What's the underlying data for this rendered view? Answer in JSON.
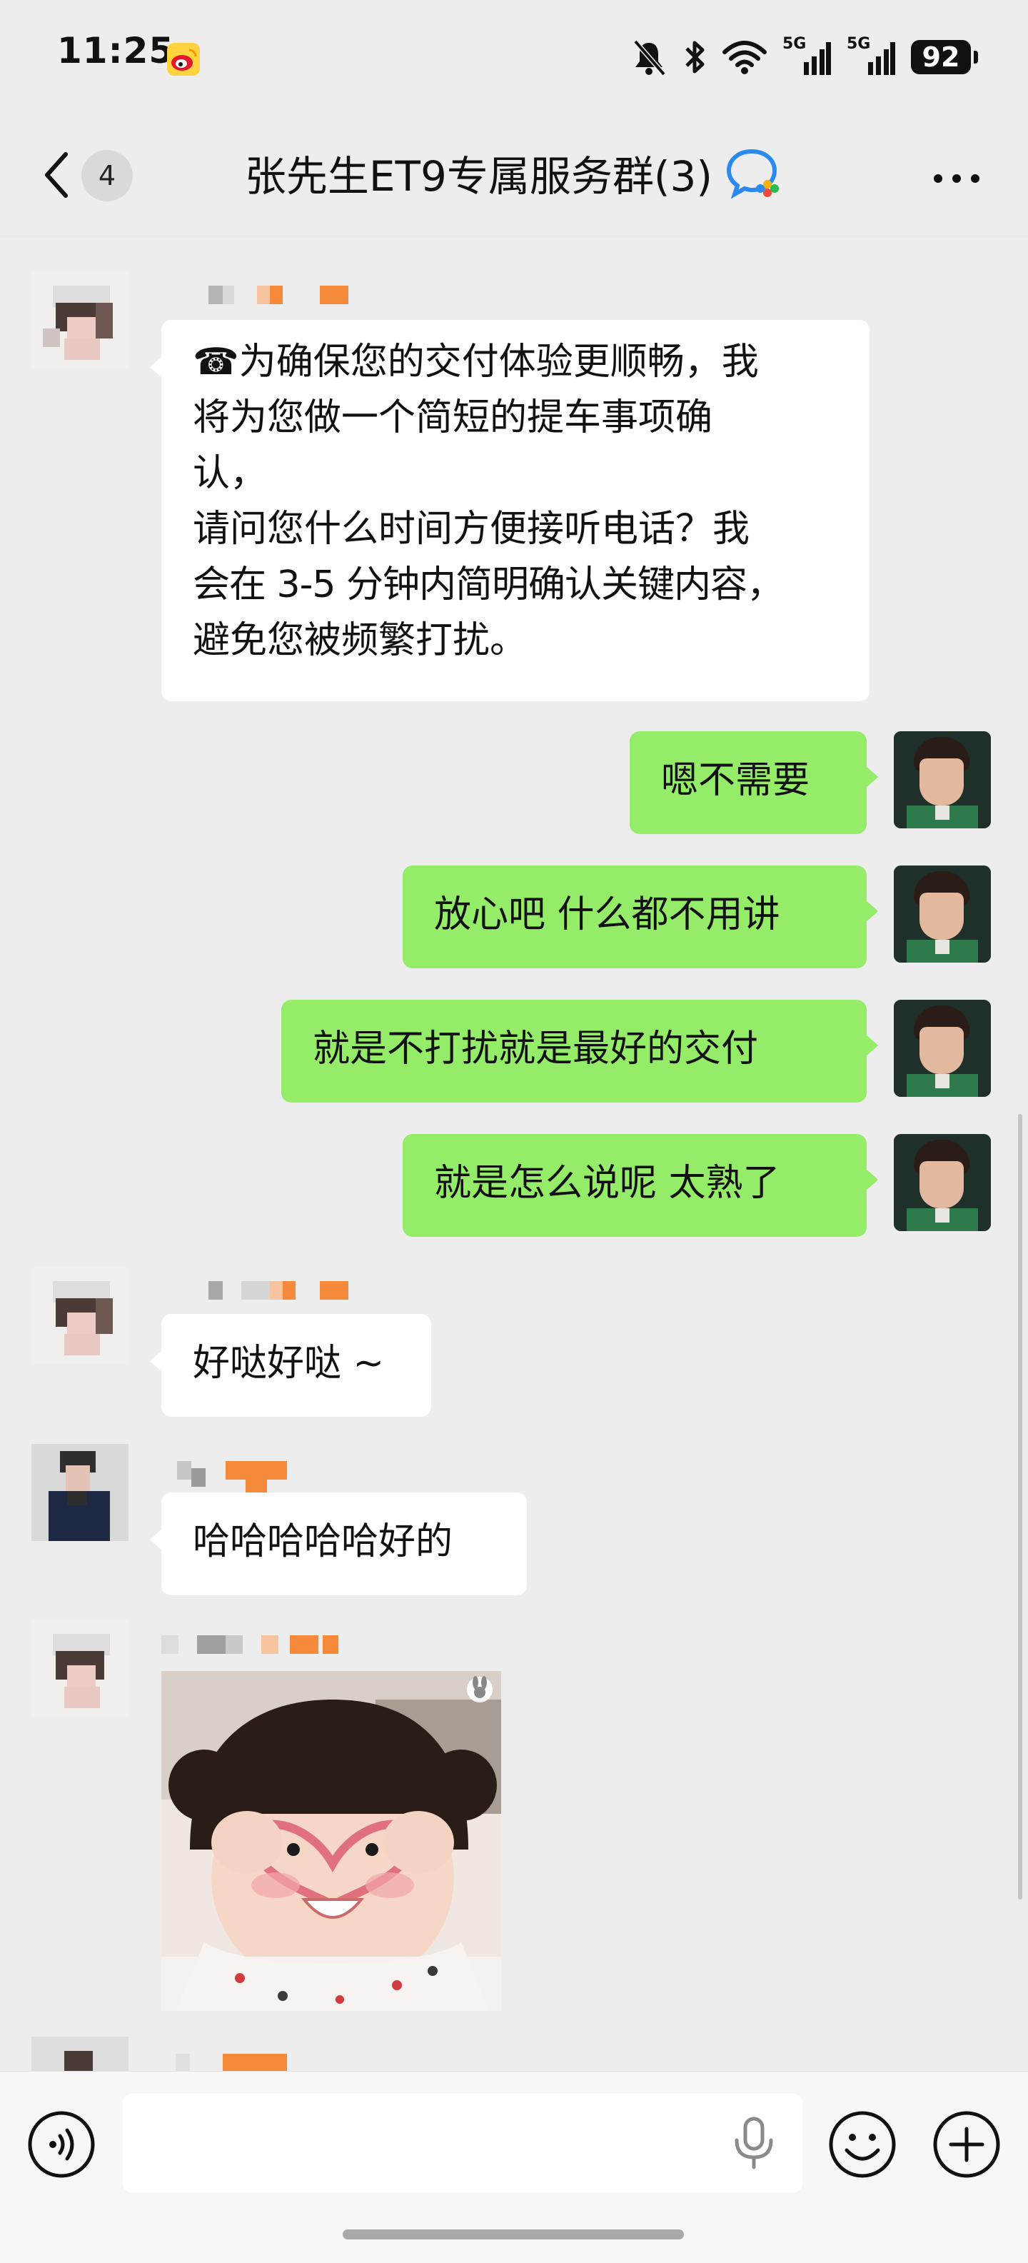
{
  "status_bar": {
    "time": "11:25",
    "network_1": "5G",
    "network_2": "5G",
    "battery": "92"
  },
  "header": {
    "unread_count": "4",
    "title": "张先生ET9专属服务群(3)"
  },
  "messages": [
    {
      "side": "in",
      "text_lines": [
        "☎为确保您的交付体验更顺畅，我",
        "将为您做一个简短的提车事项确",
        "认，",
        "请问您什么时间方便接听电话？我",
        "会在 3-5 分钟内简明确认关键内容，",
        "避免您被频繁打扰。"
      ]
    },
    {
      "side": "out",
      "text": "嗯不需要"
    },
    {
      "side": "out",
      "text": "放心吧 什么都不用讲"
    },
    {
      "side": "out",
      "text": "就是不打扰就是最好的交付"
    },
    {
      "side": "out",
      "text": "就是怎么说呢 太熟了"
    },
    {
      "side": "in",
      "text": "好哒好哒 ~"
    },
    {
      "side": "in",
      "text": "哈哈哈哈哈好的"
    },
    {
      "side": "in",
      "type": "sticker"
    }
  ],
  "input": {
    "value": "",
    "placeholder": ""
  },
  "colors": {
    "outgoing_bubble": "#95ec69",
    "incoming_bubble": "#ffffff",
    "background": "#ededed",
    "nickname_accent": "#f58a3a"
  },
  "icons": [
    "weibo-icon",
    "mute-bell-icon",
    "bluetooth-icon",
    "wifi-icon",
    "signal-icon",
    "battery-icon",
    "back-chevron-icon",
    "wecom-icon",
    "more-icon",
    "voice-icon",
    "mic-icon",
    "emoji-icon",
    "plus-icon"
  ]
}
